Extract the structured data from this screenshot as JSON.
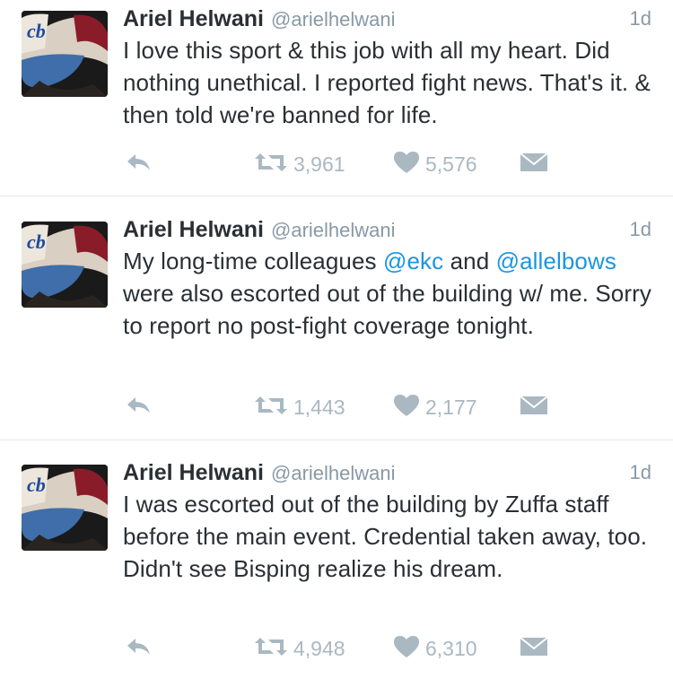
{
  "tweets": [
    {
      "name": "Ariel Helwani",
      "handle": "@arielhelwani",
      "time": "1d",
      "text_parts": [
        "I love this sport & this job with all my heart. Did nothing unethical. I reported fight news. That's it. & then told we're banned for life."
      ],
      "retweets": "3,961",
      "likes": "5,576"
    },
    {
      "name": "Ariel Helwani",
      "handle": "@arielhelwani",
      "time": "1d",
      "text_parts": [
        "My long-time colleagues ",
        "@ekc",
        " and ",
        "@allelbows",
        " were also escorted out of the building w/ me. Sorry to report no post-fight coverage tonight."
      ],
      "retweets": "1,443",
      "likes": "2,177"
    },
    {
      "name": "Ariel Helwani",
      "handle": "@arielhelwani",
      "time": "1d",
      "text_parts": [
        "I was escorted out of the building by Zuffa staff before the main event. Credential taken away, too. Didn't see Bisping realize his dream."
      ],
      "retweets": "4,948",
      "likes": "6,310"
    }
  ],
  "icons": {
    "reply": "reply-icon",
    "retweet": "retweet-icon",
    "like": "heart-icon",
    "dm": "direct-message-icon"
  },
  "colors": {
    "mention": "#1b95e0",
    "secondary": "#8899a6",
    "action": "#aab8c2",
    "divider": "#e1e8ed"
  }
}
